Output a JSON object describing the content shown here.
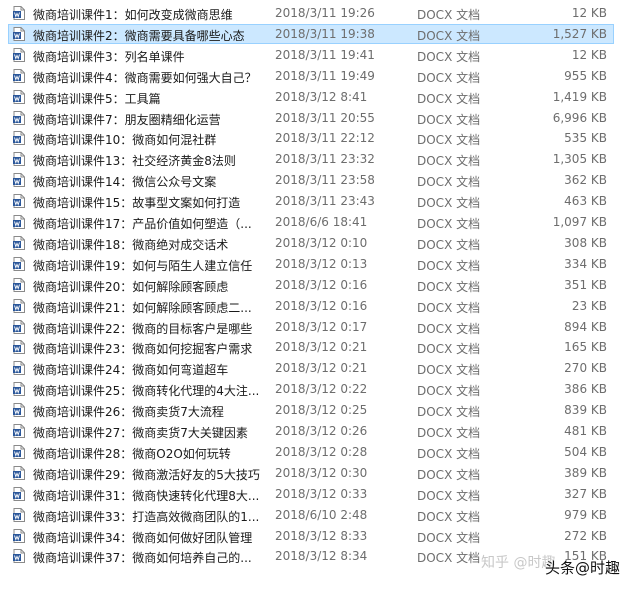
{
  "files": [
    {
      "name": "微商培训课件1：如何改变成微商思维",
      "date": "2018/3/11 19:26",
      "type": "DOCX 文档",
      "size": "12 KB"
    },
    {
      "name": "微商培训课件2：微商需要具备哪些心态",
      "date": "2018/3/11 19:38",
      "type": "DOCX 文档",
      "size": "1,527 KB",
      "selected": true
    },
    {
      "name": "微商培训课件3：列名单课件",
      "date": "2018/3/11 19:41",
      "type": "DOCX 文档",
      "size": "12 KB"
    },
    {
      "name": "微商培训课件4：微商需要如何强大自己？",
      "date": "2018/3/11 19:49",
      "type": "DOCX 文档",
      "size": "955 KB"
    },
    {
      "name": "微商培训课件5：工具篇",
      "date": "2018/3/12 8:41",
      "type": "DOCX 文档",
      "size": "1,419 KB"
    },
    {
      "name": "微商培训课件7：朋友圈精细化运营",
      "date": "2018/3/11 20:55",
      "type": "DOCX 文档",
      "size": "6,996 KB"
    },
    {
      "name": "微商培训课件10：微商如何混社群",
      "date": "2018/3/11 22:12",
      "type": "DOCX 文档",
      "size": "535 KB"
    },
    {
      "name": "微商培训课件13：社交经济黄金8法则",
      "date": "2018/3/11 23:32",
      "type": "DOCX 文档",
      "size": "1,305 KB"
    },
    {
      "name": "微商培训课件14：微信公众号文案",
      "date": "2018/3/11 23:58",
      "type": "DOCX 文档",
      "size": "362 KB"
    },
    {
      "name": "微商培训课件15：故事型文案如何打造",
      "date": "2018/3/11 23:43",
      "type": "DOCX 文档",
      "size": "463 KB"
    },
    {
      "name": "微商培训课件17：产品价值如何塑造（...",
      "date": "2018/6/6 18:41",
      "type": "DOCX 文档",
      "size": "1,097 KB"
    },
    {
      "name": "微商培训课件18：微商绝对成交话术",
      "date": "2018/3/12 0:10",
      "type": "DOCX 文档",
      "size": "308 KB"
    },
    {
      "name": "微商培训课件19：如何与陌生人建立信任",
      "date": "2018/3/12 0:13",
      "type": "DOCX 文档",
      "size": "334 KB"
    },
    {
      "name": "微商培训课件20：如何解除顾客顾虑",
      "date": "2018/3/12 0:16",
      "type": "DOCX 文档",
      "size": "351 KB"
    },
    {
      "name": "微商培训课件21：如何解除顾客顾虑二...",
      "date": "2018/3/12 0:16",
      "type": "DOCX 文档",
      "size": "23 KB"
    },
    {
      "name": "微商培训课件22：微商的目标客户是哪些",
      "date": "2018/3/12 0:17",
      "type": "DOCX 文档",
      "size": "894 KB"
    },
    {
      "name": "微商培训课件23：微商如何挖掘客户需求",
      "date": "2018/3/12 0:21",
      "type": "DOCX 文档",
      "size": "165 KB"
    },
    {
      "name": "微商培训课件24：微商如何弯道超车",
      "date": "2018/3/12 0:21",
      "type": "DOCX 文档",
      "size": "270 KB"
    },
    {
      "name": "微商培训课件25：微商转化代理的4大注...",
      "date": "2018/3/12 0:22",
      "type": "DOCX 文档",
      "size": "386 KB"
    },
    {
      "name": "微商培训课件26：微商卖货7大流程",
      "date": "2018/3/12 0:25",
      "type": "DOCX 文档",
      "size": "839 KB"
    },
    {
      "name": "微商培训课件27：微商卖货7大关键因素",
      "date": "2018/3/12 0:26",
      "type": "DOCX 文档",
      "size": "481 KB"
    },
    {
      "name": "微商培训课件28：微商O2O如何玩转",
      "date": "2018/3/12 0:28",
      "type": "DOCX 文档",
      "size": "504 KB"
    },
    {
      "name": "微商培训课件29：微商激活好友的5大技巧",
      "date": "2018/3/12 0:30",
      "type": "DOCX 文档",
      "size": "389 KB"
    },
    {
      "name": "微商培训课件31：微商快速转化代理8大...",
      "date": "2018/3/12 0:33",
      "type": "DOCX 文档",
      "size": "327 KB"
    },
    {
      "name": "微商培训课件33：打造高效微商团队的1...",
      "date": "2018/6/10 2:48",
      "type": "DOCX 文档",
      "size": "979 KB"
    },
    {
      "name": "微商培训课件34：微商如何做好团队管理",
      "date": "2018/3/12 8:33",
      "type": "DOCX 文档",
      "size": "272 KB"
    },
    {
      "name": "微商培训课件37：微商如何培养自己的...",
      "date": "2018/3/12 8:34",
      "type": "DOCX 文档",
      "size": "151 KB"
    }
  ],
  "watermark": "知乎 @时趣",
  "attribution": "头条@时趣",
  "colors": {
    "selected_bg": "#cce8ff",
    "selected_border": "#99d1ff",
    "docx_blue": "#2b579a"
  },
  "icon": "docx-file-icon"
}
